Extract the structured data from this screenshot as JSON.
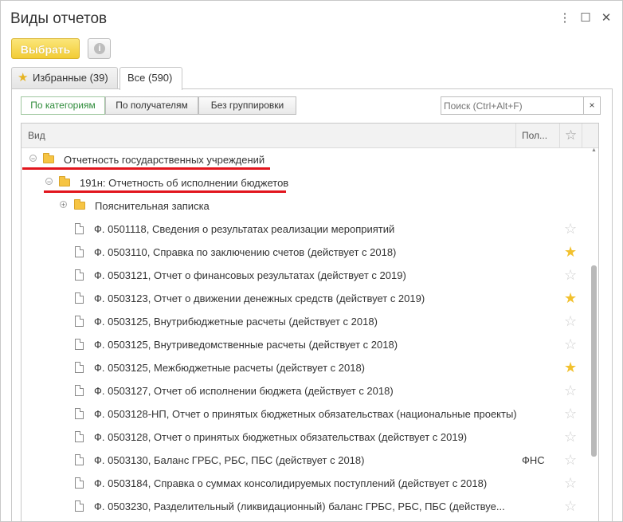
{
  "window": {
    "title": "Виды отчетов"
  },
  "toolbar": {
    "select_label": "Выбрать",
    "info_glyph": "i"
  },
  "tabs": [
    {
      "label": "Избранные (39)",
      "icon": "star-icon"
    },
    {
      "label": "Все (590)"
    }
  ],
  "grouping": [
    "По категориям",
    "По получателям",
    "Без группировки"
  ],
  "search": {
    "placeholder": "Поиск (Ctrl+Alt+F)",
    "clear_glyph": "×"
  },
  "columns": {
    "name": "Вид",
    "recipient": "Пол...",
    "favorite_glyph": "☆"
  },
  "rows": [
    {
      "level": 0,
      "kind": "folder",
      "expander": "−",
      "label": "Отчетность государственных учреждений",
      "recipient": "",
      "favorite": null
    },
    {
      "level": 1,
      "kind": "folder",
      "expander": "−",
      "label": "191н: Отчетность об исполнении бюджетов",
      "recipient": "",
      "favorite": null
    },
    {
      "level": 2,
      "kind": "folder",
      "expander": "+",
      "label": "Пояснительная записка",
      "recipient": "",
      "favorite": null
    },
    {
      "level": 3,
      "kind": "doc",
      "label": "Ф. 0501118, Сведения о результатах реализации мероприятий",
      "recipient": "",
      "favorite": false
    },
    {
      "level": 3,
      "kind": "doc",
      "label": "Ф. 0503110, Справка по заключению счетов (действует с 2018)",
      "recipient": "",
      "favorite": true
    },
    {
      "level": 3,
      "kind": "doc",
      "label": "Ф. 0503121, Отчет о финансовых результатах (действует с 2019)",
      "recipient": "",
      "favorite": false
    },
    {
      "level": 3,
      "kind": "doc",
      "label": "Ф. 0503123, Отчет о движении денежных средств (действует с 2019)",
      "recipient": "",
      "favorite": true
    },
    {
      "level": 3,
      "kind": "doc",
      "label": "Ф. 0503125, Внутрибюджетные расчеты (действует с 2018)",
      "recipient": "",
      "favorite": false
    },
    {
      "level": 3,
      "kind": "doc",
      "label": "Ф. 0503125, Внутриведомственные расчеты (действует с 2018)",
      "recipient": "",
      "favorite": false
    },
    {
      "level": 3,
      "kind": "doc",
      "label": "Ф. 0503125, Межбюджетные расчеты (действует с 2018)",
      "recipient": "",
      "favorite": true
    },
    {
      "level": 3,
      "kind": "doc",
      "label": "Ф. 0503127, Отчет об исполнении бюджета (действует с 2018)",
      "recipient": "",
      "favorite": false
    },
    {
      "level": 3,
      "kind": "doc",
      "label": "Ф. 0503128-НП, Отчет о принятых бюджетных обязательствах (национальные проекты)",
      "recipient": "",
      "favorite": false
    },
    {
      "level": 3,
      "kind": "doc",
      "label": "Ф. 0503128, Отчет о принятых бюджетных обязательствах (действует с 2019)",
      "recipient": "",
      "favorite": false
    },
    {
      "level": 3,
      "kind": "doc",
      "label": "Ф. 0503130, Баланс ГРБС, РБС, ПБС (действует с 2018)",
      "recipient": "ФНС",
      "favorite": false
    },
    {
      "level": 3,
      "kind": "doc",
      "label": "Ф. 0503184, Справка о суммах консолидируемых поступлений (действует с 2018)",
      "recipient": "",
      "favorite": false
    },
    {
      "level": 3,
      "kind": "doc",
      "label": "Ф. 0503230, Разделительный (ликвидационный) баланс ГРБС, РБС, ПБС (действуе...",
      "recipient": "",
      "favorite": false
    }
  ],
  "colors": {
    "accent_yellow": "#f2cc35",
    "star_on": "#f2c12e",
    "annotation_red": "#e2151d",
    "active_group_green": "#2e8b3a"
  }
}
